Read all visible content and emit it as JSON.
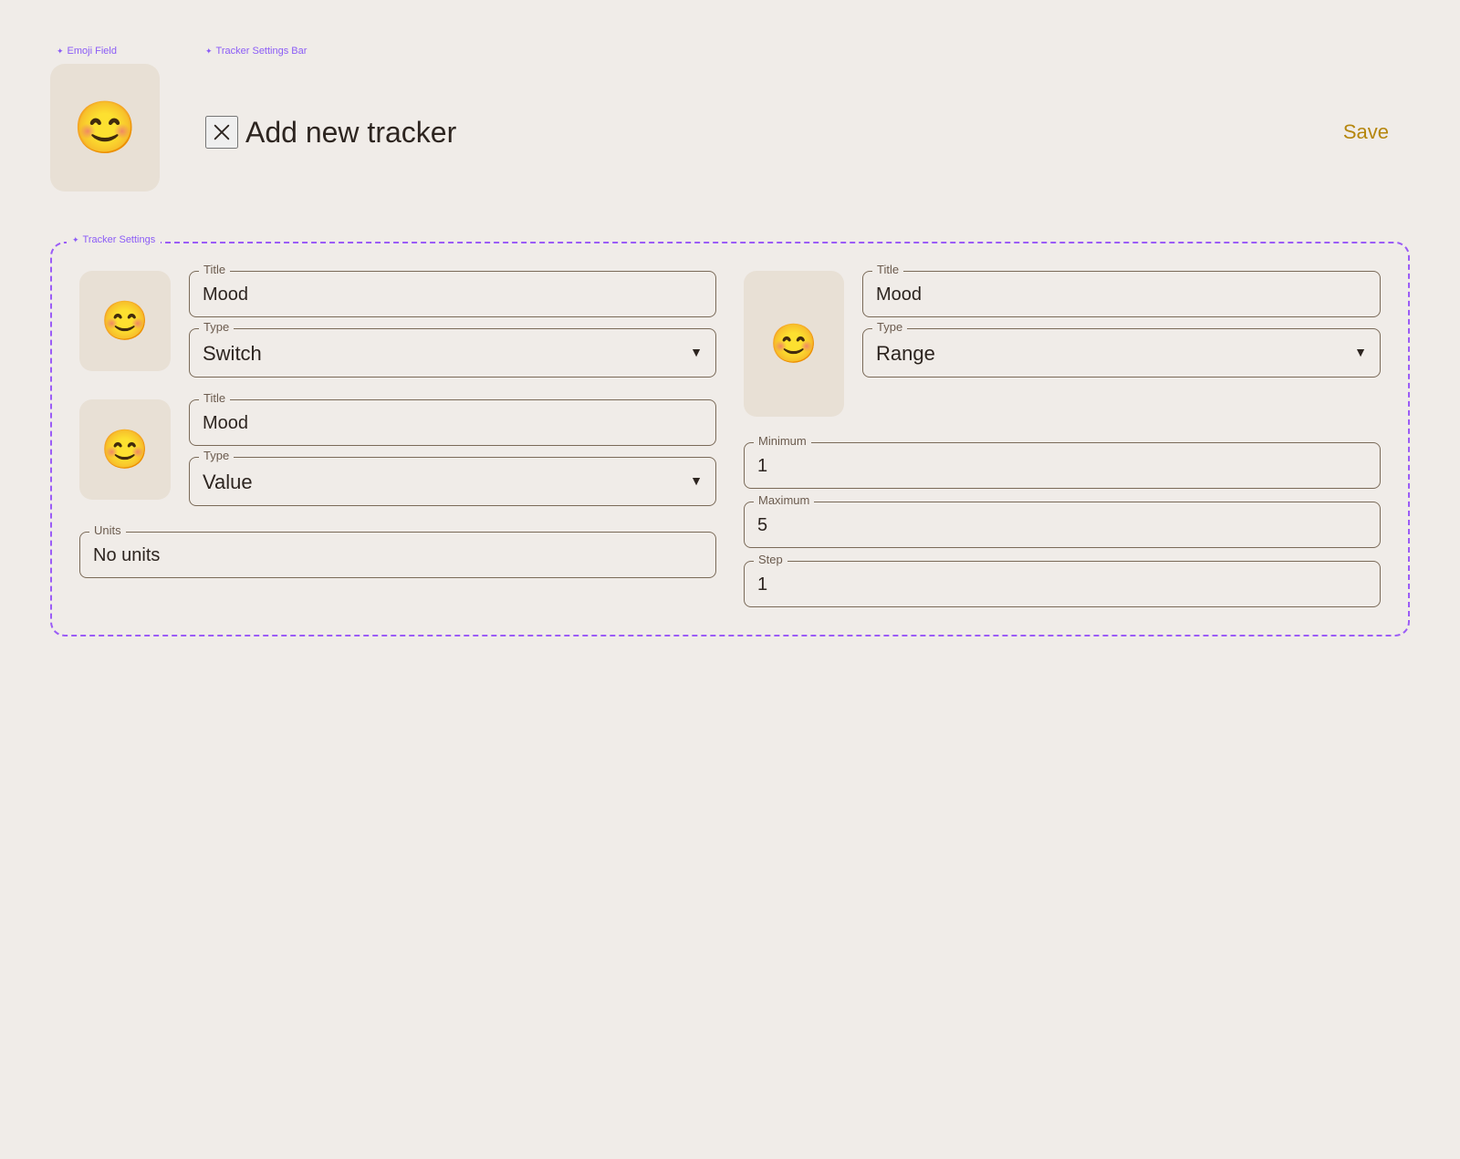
{
  "annotations": {
    "emoji_field_label": "Emoji Field",
    "tracker_bar_label": "Tracker Settings Bar",
    "tracker_settings_label": "Tracker Settings"
  },
  "emoji_field": {
    "emoji": "😊"
  },
  "tracker_bar": {
    "title": "Add new tracker",
    "save_label": "Save",
    "close_icon": "✕"
  },
  "tracker_settings": {
    "left_items": [
      {
        "emoji": "😊",
        "title_label": "Title",
        "title_value": "Mood",
        "type_label": "Type",
        "type_value": "Switch"
      },
      {
        "emoji": "😊",
        "title_label": "Title",
        "title_value": "Mood",
        "type_label": "Type",
        "type_value": "Value",
        "units_label": "Units",
        "units_value": "No units"
      }
    ],
    "right_item": {
      "emoji": "😊",
      "title_label": "Title",
      "title_value": "Mood",
      "type_label": "Type",
      "type_value": "Range",
      "minimum_label": "Minimum",
      "minimum_value": "1",
      "maximum_label": "Maximum",
      "maximum_value": "5",
      "step_label": "Step",
      "step_value": "1"
    }
  },
  "colors": {
    "accent_purple": "#8b5cf6",
    "accent_gold": "#b5860d",
    "border_color": "#7a6a58",
    "text_dark": "#2d2520",
    "card_bg": "#e8e0d5",
    "page_bg": "#f0ece8"
  }
}
